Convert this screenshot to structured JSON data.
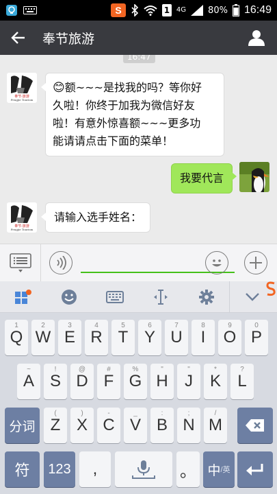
{
  "status_bar": {
    "time": "16:49",
    "battery": "80%",
    "network": "4G",
    "sim_badge": "1"
  },
  "header": {
    "title": "奉节旅游",
    "back_icon": "arrow-left-icon",
    "profile_icon": "person-icon"
  },
  "chat": {
    "timestamp": "16:47",
    "messages": [
      {
        "from": "bot",
        "emoji": "😊",
        "text_lines": [
          "额~~~是找我的吗？等你好",
          "久啦！你终于加我为微信好友",
          "啦！有意外惊喜额~~~更多功",
          "能请请点击下面的菜单！"
        ]
      },
      {
        "from": "user",
        "text": "我要代言"
      },
      {
        "from": "bot",
        "text": "请输入选手姓名："
      }
    ],
    "bot_logo": {
      "line1": "奉节·旅游",
      "line2": "Fengjie Tourism"
    }
  },
  "input_bar": {
    "value": ""
  },
  "keyboard": {
    "row1": [
      {
        "main": "Q",
        "sub": "1"
      },
      {
        "main": "W",
        "sub": "2"
      },
      {
        "main": "E",
        "sub": "3"
      },
      {
        "main": "R",
        "sub": "4"
      },
      {
        "main": "T",
        "sub": "5"
      },
      {
        "main": "Y",
        "sub": "6"
      },
      {
        "main": "U",
        "sub": "7"
      },
      {
        "main": "I",
        "sub": "8"
      },
      {
        "main": "O",
        "sub": "9"
      },
      {
        "main": "P",
        "sub": "0"
      }
    ],
    "row2": [
      {
        "main": "A",
        "sub": "~"
      },
      {
        "main": "S",
        "sub": "!"
      },
      {
        "main": "D",
        "sub": "@"
      },
      {
        "main": "F",
        "sub": "#"
      },
      {
        "main": "G",
        "sub": "%"
      },
      {
        "main": "H",
        "sub": "\""
      },
      {
        "main": "J",
        "sub": "\""
      },
      {
        "main": "K",
        "sub": "*"
      },
      {
        "main": "L",
        "sub": "?"
      }
    ],
    "row3": [
      {
        "main": "Z",
        "sub": "("
      },
      {
        "main": "X",
        "sub": ")"
      },
      {
        "main": "C",
        "sub": "-"
      },
      {
        "main": "V",
        "sub": "_"
      },
      {
        "main": "B",
        "sub": ":"
      },
      {
        "main": "N",
        "sub": ";"
      },
      {
        "main": "M",
        "sub": "/"
      }
    ],
    "segment_key": "分词",
    "symbol_key": "符",
    "number_key": "123",
    "comma_key": ",",
    "period_key": "。",
    "lang_key_main": "中",
    "lang_key_alt": "/英"
  }
}
